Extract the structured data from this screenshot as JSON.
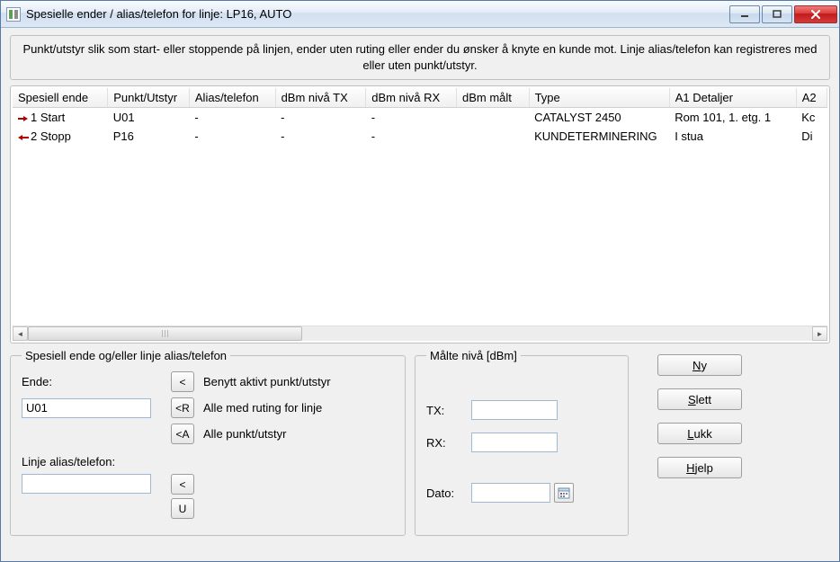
{
  "window": {
    "title": "Spesielle ender / alias/telefon for linje: LP16, AUTO"
  },
  "info": {
    "text": "Punkt/utstyr slik som start- eller stoppende på linjen, ender uten ruting eller ender du ønsker å knyte en kunde mot.  Linje alias/telefon kan registreres med eller uten punkt/utstyr."
  },
  "grid": {
    "columns": {
      "c0": "Spesiell ende",
      "c1": "Punkt/Utstyr",
      "c2": "Alias/telefon",
      "c3": "dBm nivå TX",
      "c4": "dBm nivå RX",
      "c5": "dBm målt",
      "c6": "Type",
      "c7": "A1 Detaljer",
      "c8": "A2"
    },
    "rows": [
      {
        "c0": "1 Start",
        "c1": "U01",
        "c2": "-",
        "c3": "-",
        "c4": "-",
        "c5": "",
        "c6": "CATALYST 2450",
        "c7": "Rom 101, 1. etg. 1",
        "c8": "Kc"
      },
      {
        "c0": "2 Stopp",
        "c1": "P16",
        "c2": "-",
        "c3": "-",
        "c4": "-",
        "c5": "",
        "c6": "KUNDETERMINERING",
        "c7": "I stua",
        "c8": "Di"
      }
    ]
  },
  "ends": {
    "legend": "Spesiell ende og/eller linje alias/telefon",
    "ende_label": "Ende:",
    "ende_value": "U01",
    "btn_lt": "<",
    "btn_lt_desc": "Benytt aktivt punkt/utstyr",
    "btn_ltR": "<R",
    "btn_ltR_desc": "Alle med ruting for linje",
    "btn_ltA": "<A",
    "btn_ltA_desc": "Alle punkt/utstyr",
    "alias_label": "Linje alias/telefon:",
    "alias_value": "",
    "btn_lt2": "<",
    "btn_U": "U"
  },
  "levels": {
    "legend": "Målte nivå [dBm]",
    "tx_label": "TX:",
    "tx_value": "",
    "rx_label": "RX:",
    "rx_value": "",
    "date_label": "Dato:",
    "date_value": ""
  },
  "buttons": {
    "ny": "Ny",
    "slett": "Slett",
    "lukk": "Lukk",
    "hjelp": "Hjelp"
  }
}
